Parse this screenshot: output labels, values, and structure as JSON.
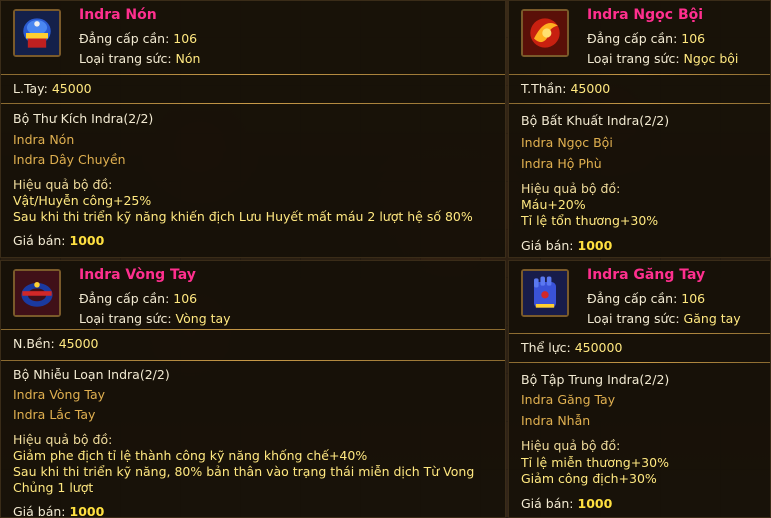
{
  "labels": {
    "level": "Đẳng cấp cần:",
    "type": "Loại trang sức:",
    "effect": "Hiệu quả bộ đồ:",
    "price": "Giá bán:"
  },
  "cards": [
    {
      "name": "Indra Nón",
      "level": "106",
      "type": "Nón",
      "stat_label": "L.Tay:",
      "stat_value": "45000",
      "set_name": "Bộ Thư Kích Indra(2/2)",
      "set_items": [
        "Indra Nón",
        "Indra Dây Chuyền"
      ],
      "effects": [
        "Vật/Huyễn công+25%",
        "Sau khi thi triển kỹ năng khiến địch Lưu Huyết mất máu 2 lượt hệ số 80%"
      ],
      "price": "1000",
      "icon": "helmet-icon"
    },
    {
      "name": "Indra Ngọc Bội",
      "level": "106",
      "type": "Ngọc bội",
      "stat_label": "T.Thần:",
      "stat_value": "45000",
      "set_name": "Bộ Bất Khuất Indra(2/2)",
      "set_items": [
        "Indra Ngọc Bội",
        "Indra Hộ Phù"
      ],
      "effects": [
        "Máu+20%",
        "Tỉ lệ tổn thương+30%"
      ],
      "price": "1000",
      "icon": "jade-pendant-icon"
    },
    {
      "name": "Indra Vòng Tay",
      "level": "106",
      "type": "Vòng tay",
      "stat_label": "N.Bền:",
      "stat_value": "45000",
      "set_name": "Bộ Nhiễu Loạn Indra(2/2)",
      "set_items": [
        "Indra Vòng Tay",
        "Indra Lắc Tay"
      ],
      "effects": [
        "Giảm phe địch tỉ lệ thành công kỹ năng khống chế+40%",
        "Sau khi thi triển kỹ năng, 80% bản thân vào trạng thái miễn dịch Từ Vong",
        "Chủng 1 lượt"
      ],
      "price": "1000",
      "icon": "bracelet-icon"
    },
    {
      "name": "Indra Găng Tay",
      "level": "106",
      "type": "Găng tay",
      "stat_label": "Thể lực:",
      "stat_value": "450000",
      "set_name": "Bộ Tập Trung Indra(2/2)",
      "set_items": [
        "Indra Găng Tay",
        "Indra Nhẫn"
      ],
      "effects": [
        "Tỉ lệ miễn thương+30%",
        "Giảm công địch+30%"
      ],
      "price": "1000",
      "icon": "glove-icon"
    }
  ]
}
